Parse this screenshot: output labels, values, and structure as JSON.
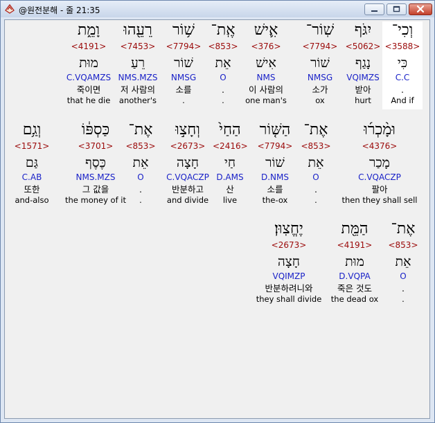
{
  "window": {
    "title": "@원전분해 - 줄 21:35",
    "icon": "app-logo-icon",
    "buttons": [
      {
        "name": "minimize-button",
        "icon": "minimize-icon"
      },
      {
        "name": "maximize-button",
        "icon": "maximize-icon"
      },
      {
        "name": "close-button",
        "icon": "close-icon"
      }
    ]
  },
  "colors": {
    "strong": "#9b0a0a",
    "morph": "#1a22c8",
    "text": "#000000",
    "content_bg": "#f0f0f0",
    "selected_bg": "#ffffff"
  },
  "rows": [
    {
      "words": [
        {
          "heb": "וְכִי־",
          "strong": "<3588>",
          "lemma": "כִּי",
          "morph": "C.C",
          "ko": ".",
          "en": "And if"
        },
        {
          "heb": "יִגֹּף",
          "strong": "<5062>",
          "lemma": "נָגַף",
          "morph": "VQIMZS",
          "ko": "받아",
          "en": "hurt"
        },
        {
          "heb": "שֽׁוֹר־",
          "strong": "<7794>",
          "lemma": "שׁוֹר",
          "morph": "NMSG",
          "ko": "소가",
          "en": "ox"
        },
        {
          "heb": "אִ֛ישׁ",
          "strong": "<376>",
          "lemma": "אִישׁ",
          "morph": "NMS",
          "ko": "이 사람의",
          "en": "one man's"
        },
        {
          "heb": "אֶֽת־",
          "strong": "<853>",
          "lemma": "אֵת",
          "morph": "O",
          "ko": ".",
          "en": "."
        },
        {
          "heb": "שׁ֥וֹר",
          "strong": "<7794>",
          "lemma": "שׁוֹר",
          "morph": "NMSG",
          "ko": "소를",
          "en": "."
        },
        {
          "heb": "רֵעֵ֖הוּ",
          "strong": "<7453>",
          "lemma": "רֵעַ",
          "morph": "NMS.MZS",
          "ko": "저 사람의",
          "en": "another's"
        },
        {
          "heb": "וָמֵ֑ת",
          "strong": "<4191>",
          "lemma": "מוּת",
          "morph": "C.VQAMZS",
          "ko": "죽이면",
          "en": "that he die"
        }
      ]
    },
    {
      "words": [
        {
          "heb": "וּמָ֨כְר֜וּ",
          "strong": "<4376>",
          "lemma": "מָכַר",
          "morph": "C.VQACZP",
          "ko": "팔아",
          "en": "then they shall sell"
        },
        {
          "heb": "אֶת־",
          "strong": "<853>",
          "lemma": "אֵת",
          "morph": "O",
          "ko": ".",
          "en": "."
        },
        {
          "heb": "הַשּׁ֤וֹר",
          "strong": "<7794>",
          "lemma": "שׁוֹר",
          "morph": "D.NMS",
          "ko": "소를",
          "en": "the-ox"
        },
        {
          "heb": "הַחַי֙",
          "strong": "<2416>",
          "lemma": "חַי",
          "morph": "D.AMS",
          "ko": "산",
          "en": "live"
        },
        {
          "heb": "וְחָצ֣וּ",
          "strong": "<2673>",
          "lemma": "חָצָה",
          "morph": "C.VQACZP",
          "ko": "반분하고",
          "en": "and divide"
        },
        {
          "heb": "אֶת־",
          "strong": "<853>",
          "lemma": "אֵת",
          "morph": "O",
          "ko": ".",
          "en": "."
        },
        {
          "heb": "כַּסְפּ֔וֹ",
          "strong": "<3701>",
          "lemma": "כֶּסֶף",
          "morph": "NMS.MZS",
          "ko": "그 값을",
          "en": "the money of it"
        },
        {
          "heb": "וְגַ֥ם",
          "strong": "<1571>",
          "lemma": "גַּם",
          "morph": "C.AB",
          "ko": "또한",
          "en": "and-also"
        }
      ]
    },
    {
      "words": [
        {
          "heb": "אֶת־",
          "strong": "<853>",
          "lemma": "אֵת",
          "morph": "O",
          "ko": ".",
          "en": "."
        },
        {
          "heb": "הַמֵּ֖ת",
          "strong": "<4191>",
          "lemma": "מוּת",
          "morph": "D.VQPA",
          "ko": "죽은 것도",
          "en": "the dead ox"
        },
        {
          "heb": "יֶחֱצֽוּן׃",
          "strong": "<2673>",
          "lemma": "חָצָה",
          "morph": "VQIMZP",
          "ko": "반분하려니와",
          "en": "they shall divide"
        }
      ]
    }
  ]
}
